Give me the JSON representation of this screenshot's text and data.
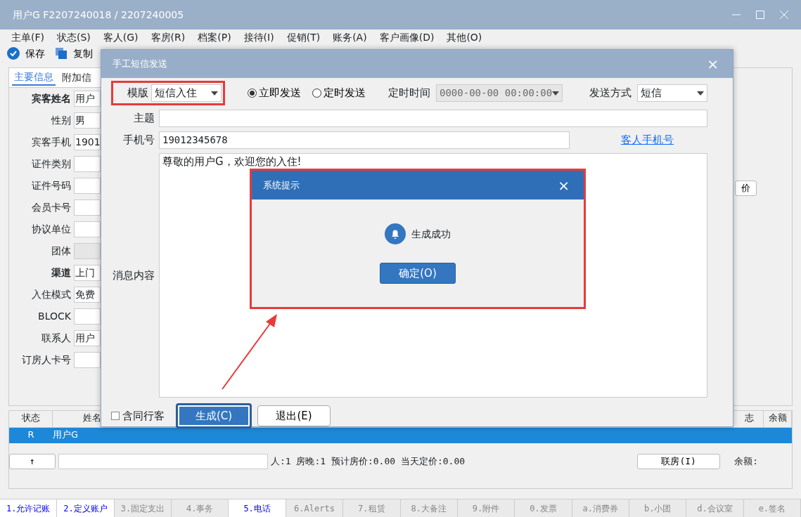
{
  "window": {
    "title": "用户G  F2207240018 / 2207240005"
  },
  "menu": [
    "主单(F)",
    "状态(S)",
    "客人(G)",
    "客房(R)",
    "档案(P)",
    "接待(I)",
    "促销(T)",
    "账务(A)",
    "客户画像(D)",
    "其他(O)"
  ],
  "toolbar": [
    {
      "label": "保存",
      "kind": "check"
    },
    {
      "label": "复制",
      "kind": "copy"
    }
  ],
  "tabs": [
    {
      "label": "主要信息",
      "selected": true
    },
    {
      "label": "附加信",
      "selected": false
    }
  ],
  "form": [
    {
      "label": "宾客姓名",
      "bold": true,
      "value": "用户",
      "disabled": false
    },
    {
      "label": "性别",
      "bold": false,
      "value": "男",
      "disabled": false
    },
    {
      "label": "宾客手机",
      "bold": false,
      "value": "1901",
      "disabled": false
    },
    {
      "label": "证件类别",
      "bold": false,
      "disabled": false
    },
    {
      "label": "证件号码",
      "bold": false,
      "disabled": false
    },
    {
      "label": "会员卡号",
      "bold": false,
      "disabled": false
    },
    {
      "label": "协议单位",
      "bold": false,
      "disabled": false
    },
    {
      "label": "团体",
      "bold": false,
      "disabled": true
    },
    {
      "label": "渠道",
      "bold": true,
      "value": "上门",
      "disabled": false
    },
    {
      "label": "入住模式",
      "bold": false,
      "value": "免费",
      "disabled": false
    },
    {
      "label": "BLOCK",
      "bold": false,
      "disabled": false
    },
    {
      "label": "联系人",
      "bold": false,
      "value": "用户",
      "disabled": false
    },
    {
      "label": "订房人卡号",
      "bold": false,
      "disabled": false
    }
  ],
  "right_button": "价",
  "table": {
    "columns": [
      "状态",
      "姓名",
      "志",
      "余额"
    ],
    "rows": [
      {
        "cells": [
          "R",
          "用户G"
        ],
        "selected": true
      }
    ]
  },
  "summary": {
    "up_button": "↑",
    "text": "人:1  房晚:1  预计房价:0.00  当天定价:0.00",
    "link_button": "联房(I)",
    "balance_label": "余额:"
  },
  "bottom_tabs": [
    {
      "label": "1.允许记账",
      "active": true
    },
    {
      "label": "2.定义账户",
      "active": true
    },
    {
      "label": "3.固定支出",
      "active": false
    },
    {
      "label": "4.事务",
      "active": false
    },
    {
      "label": "5.电话",
      "active": true
    },
    {
      "label": "6.Alerts",
      "active": false
    },
    {
      "label": "7.租赁",
      "active": false
    },
    {
      "label": "8.大备注",
      "active": false
    },
    {
      "label": "9.附件",
      "active": false
    },
    {
      "label": "0.发票",
      "active": false
    },
    {
      "label": "a.消费券",
      "active": false
    },
    {
      "label": "b.小团",
      "active": false
    },
    {
      "label": "d.会议室",
      "active": false
    },
    {
      "label": "e.签名",
      "active": false
    }
  ],
  "sms_dialog": {
    "title": "手工短信发送",
    "close": "×",
    "template": {
      "label": "模版",
      "value": "短信入住",
      "highlighted": true
    },
    "send_modes": [
      {
        "label": "立即发送",
        "selected": true
      },
      {
        "label": "定时发送",
        "selected": false
      }
    ],
    "schedule": {
      "label": "定时时间",
      "value": "0000-00-00 00:00:00",
      "disabled": true
    },
    "method": {
      "label": "发送方式",
      "value": "短信"
    },
    "subject": {
      "label": "主题"
    },
    "phone": {
      "label": "手机号",
      "value": "19012345678",
      "link": "客人手机号"
    },
    "message": {
      "label": "消息内容",
      "value": "尊敬的用户G，欢迎您的入住!"
    },
    "include_companions": {
      "label": "含同行客",
      "checked": false
    },
    "buttons": [
      {
        "label": "生成(C)",
        "kind": "primary",
        "highlighted": true
      },
      {
        "label": "退出(E)",
        "kind": "plain",
        "highlighted": false
      }
    ]
  },
  "alert_dialog": {
    "title": "系统提示",
    "close": "×",
    "message": "生成成功",
    "button": "确定(O)",
    "highlighted": true
  }
}
